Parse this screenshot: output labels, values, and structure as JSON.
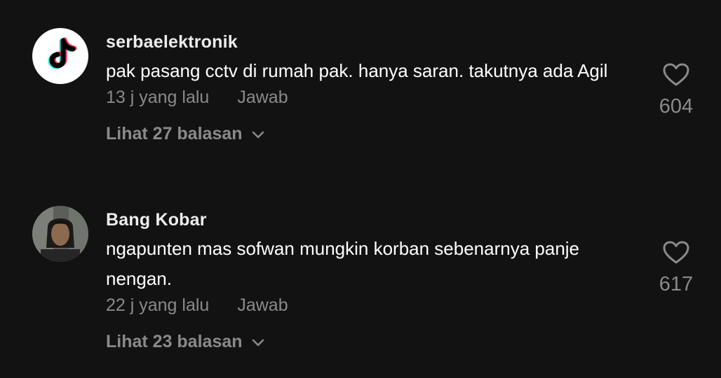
{
  "comments": [
    {
      "username": "serbaelektronik",
      "avatar_icon": "tiktok-logo-icon",
      "text": "pak pasang cctv di rumah pak. hanya saran. takutnya ada Agil",
      "time": "13 j yang lalu",
      "reply_label": "Jawab",
      "view_replies": "Lihat 27 balasan",
      "likes": "604"
    },
    {
      "username": "Bang Kobar",
      "avatar_icon": "user-photo-avatar",
      "text": "ngapunten mas sofwan mungkin korban sebenarnya panje nengan.",
      "time": "22 j yang lalu",
      "reply_label": "Jawab",
      "view_replies": "Lihat 23 balasan",
      "likes": "617"
    }
  ],
  "colors": {
    "background": "#121212",
    "secondary_text": "#8a8a8a",
    "primary_text": "#ffffff"
  }
}
